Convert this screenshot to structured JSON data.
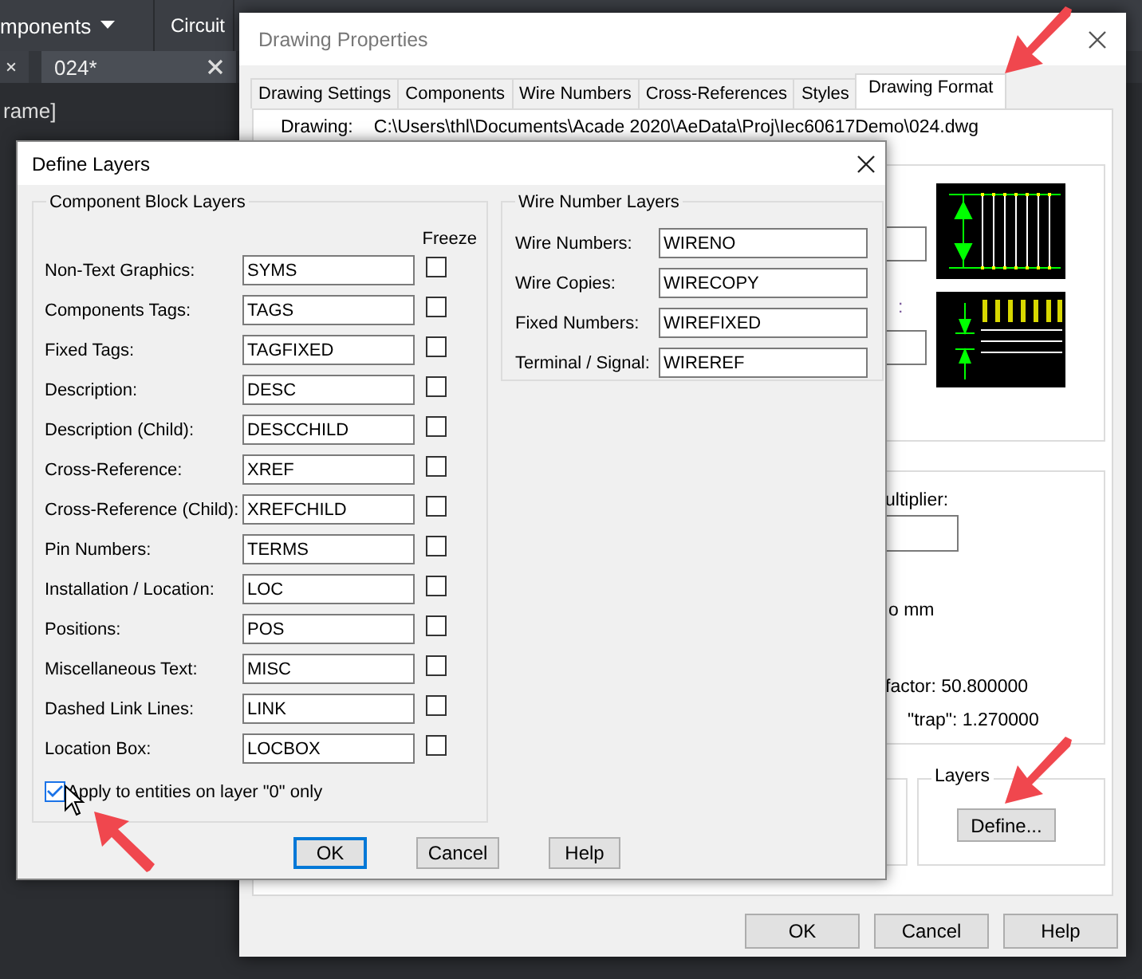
{
  "background_app": {
    "ribbon_items": [
      {
        "label": "mponents",
        "kind": "menu"
      },
      {
        "label": "Circuit",
        "kind": "plain"
      }
    ],
    "document_tabs": [
      {
        "selected": false
      },
      {
        "label": "024*",
        "selected": true
      }
    ],
    "drawing_text": "rame]"
  },
  "drawing_properties": {
    "title": "Drawing Properties",
    "tabs": [
      {
        "label": "Drawing Settings",
        "selected": false
      },
      {
        "label": "Components",
        "selected": false
      },
      {
        "label": "Wire Numbers",
        "selected": false
      },
      {
        "label": "Cross-References",
        "selected": false
      },
      {
        "label": "Styles",
        "selected": false
      },
      {
        "label": "Drawing Format",
        "selected": true
      }
    ],
    "drawing_label": "Drawing:",
    "drawing_path": "C:\\Users\\thl\\Documents\\Acade 2020\\AeData\\Proj\\Iec60617Demo\\024.dwg",
    "colon_fragment": ":",
    "multiplier_fragment": "ultiplier:",
    "unit_fragment": "o mm",
    "factor_fragment": "factor: 50.800000",
    "trap_fragment": "\"trap\": 1.270000",
    "layers_group": "Layers",
    "define_button": "Define...",
    "buttons": [
      "OK",
      "Cancel",
      "Help"
    ]
  },
  "define_layers": {
    "title": "Define Layers",
    "component_group": {
      "title": "Component Block Layers",
      "freeze_header": "Freeze",
      "rows": [
        {
          "label": "Non-Text Graphics:",
          "value": "SYMS",
          "frozen": false
        },
        {
          "label": "Components Tags:",
          "value": "TAGS",
          "frozen": false
        },
        {
          "label": "Fixed Tags:",
          "value": "TAGFIXED",
          "frozen": false
        },
        {
          "label": "Description:",
          "value": "DESC",
          "frozen": false
        },
        {
          "label": "Description (Child):",
          "value": "DESCCHILD",
          "frozen": false
        },
        {
          "label": "Cross-Reference:",
          "value": "XREF",
          "frozen": false
        },
        {
          "label": "Cross-Reference (Child):",
          "value": "XREFCHILD",
          "frozen": false
        },
        {
          "label": "Pin Numbers:",
          "value": "TERMS",
          "frozen": false
        },
        {
          "label": "Installation / Location:",
          "value": "LOC",
          "frozen": false
        },
        {
          "label": "Positions:",
          "value": "POS",
          "frozen": false
        },
        {
          "label": "Miscellaneous Text:",
          "value": "MISC",
          "frozen": false
        },
        {
          "label": "Dashed Link Lines:",
          "value": "LINK",
          "frozen": false
        },
        {
          "label": "Location Box:",
          "value": "LOCBOX",
          "frozen": false
        }
      ]
    },
    "apply_option": {
      "label": "Apply to entities on layer \"0\" only",
      "checked": true
    },
    "wire_group": {
      "title": "Wire Number Layers",
      "rows": [
        {
          "label": "Wire Numbers:",
          "value": "WIRENO"
        },
        {
          "label": "Wire Copies:",
          "value": "WIRECOPY"
        },
        {
          "label": "Fixed Numbers:",
          "value": "WIREFIXED"
        },
        {
          "label": "Terminal / Signal:",
          "value": "WIREREF"
        }
      ]
    },
    "buttons": [
      {
        "label": "OK",
        "default": true
      },
      {
        "label": "Cancel",
        "default": false
      },
      {
        "label": "Help",
        "default": false
      }
    ]
  }
}
